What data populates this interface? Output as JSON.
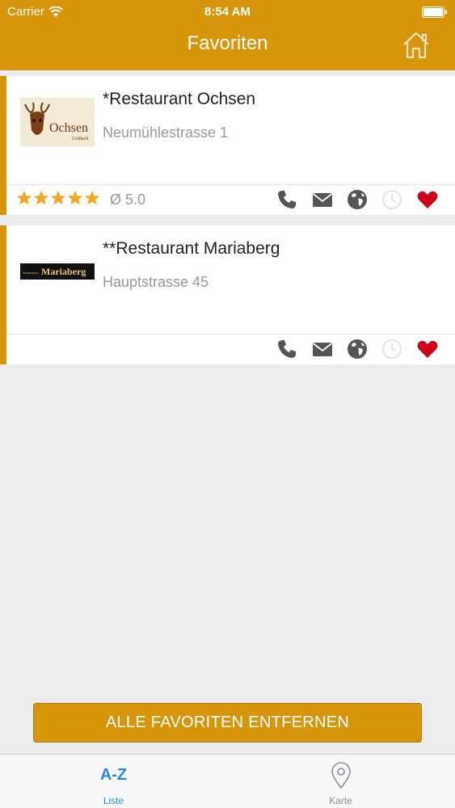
{
  "status_bar": {
    "carrier": "Carrier",
    "time": "8:54 AM"
  },
  "nav": {
    "title": "Favoriten",
    "home_icon": "home-icon"
  },
  "favorites": [
    {
      "name": "*Restaurant Ochsen",
      "address": "Neumühlestrasse 1",
      "logo_text": "Ochsen",
      "logo_subtext": "Goldach",
      "stars": 5,
      "rating": "Ø 5.0",
      "actions": [
        "phone-icon",
        "mail-icon",
        "globe-icon",
        "clock-icon",
        "heart-icon"
      ]
    },
    {
      "name": "**Restaurant Mariaberg",
      "address": "Hauptstrasse 45",
      "logo_text": "Mariaberg",
      "logo_subtext": "Restaurant",
      "actions": [
        "phone-icon",
        "mail-icon",
        "globe-icon",
        "clock-icon",
        "heart-icon"
      ]
    }
  ],
  "remove_all_label": "ALLE FAVORITEN ENTFERNEN",
  "tabs": [
    {
      "icon_text": "A-Z",
      "label": "Liste",
      "active": true
    },
    {
      "icon": "map-pin-icon",
      "label": "Karte",
      "active": false
    }
  ],
  "colors": {
    "brand": "#d6950a",
    "star": "#f5a623",
    "heart": "#d0021b",
    "icon_gray": "#555555",
    "tab_active": "#2a8ad8"
  }
}
